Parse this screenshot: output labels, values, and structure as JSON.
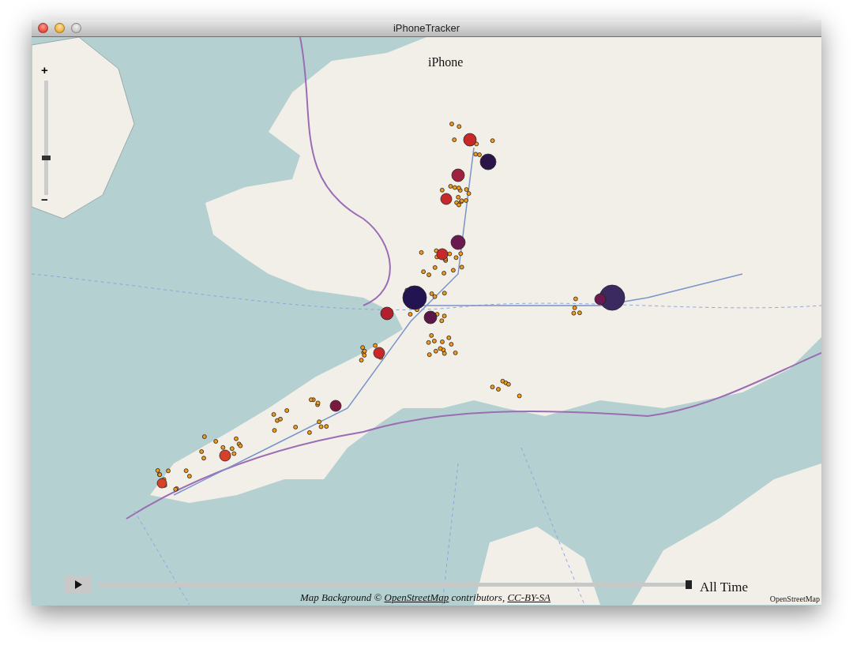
{
  "window": {
    "title": "iPhoneTracker",
    "buttons": [
      {
        "kind": "close",
        "disabled": false
      },
      {
        "kind": "minimize",
        "disabled": false
      },
      {
        "kind": "zoom",
        "disabled": true
      }
    ]
  },
  "map": {
    "heading": "iPhone",
    "zoom": {
      "plus": "+",
      "minus": "−",
      "level": 0.32
    },
    "playback": {
      "level": 1,
      "label": "All Time"
    },
    "attribution": {
      "prefix": "Map Background © ",
      "link": "OpenStreetMap",
      "middle": " contributors, ",
      "license": "CC-BY-SA"
    },
    "credit": "OpenStreetMap"
  }
}
